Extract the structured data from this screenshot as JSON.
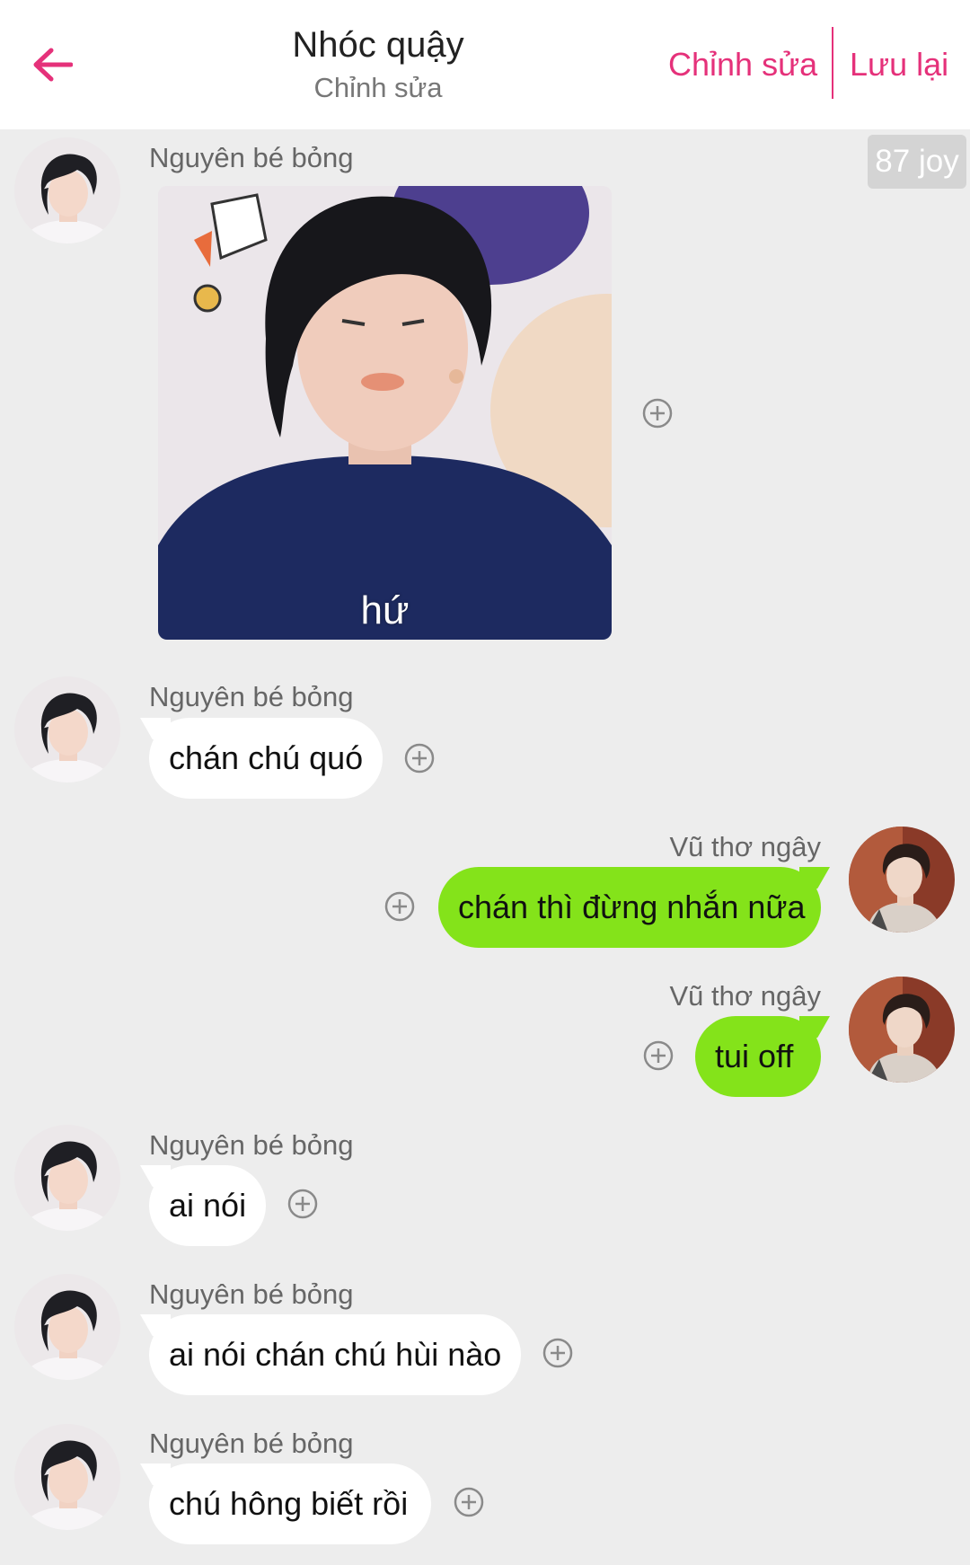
{
  "header": {
    "title": "Nhóc quậy",
    "subtitle": "Chỉnh sửa",
    "edit_label": "Chỉnh sửa",
    "save_label": "Lưu lại"
  },
  "joy_badge": "87 joy",
  "colors": {
    "accent": "#e5317a",
    "outgoing_bubble": "#84e31a",
    "incoming_bubble": "#ffffff",
    "background": "#ededed"
  },
  "messages": [
    {
      "sender": "Nguyên bé bỏng",
      "type": "sticker",
      "caption": "hứ"
    },
    {
      "sender": "Nguyên bé bỏng",
      "type": "text",
      "text": "chán chú quó"
    },
    {
      "sender": "Vũ thơ ngây",
      "type": "text",
      "text": "chán thì đừng nhắn nữa"
    },
    {
      "sender": "Vũ thơ ngây",
      "type": "text",
      "text": "tui off"
    },
    {
      "sender": "Nguyên bé bỏng",
      "type": "text",
      "text": "ai nói"
    },
    {
      "sender": "Nguyên bé bỏng",
      "type": "text",
      "text": "ai nói chán chú hùi nào"
    },
    {
      "sender": "Nguyên bé bỏng",
      "type": "text",
      "text": "chú hông biết rồi"
    }
  ]
}
